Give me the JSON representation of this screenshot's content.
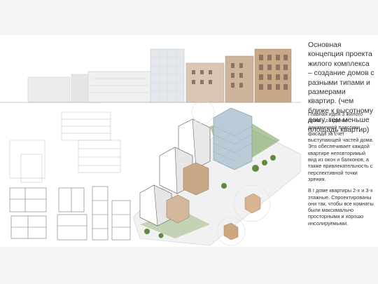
{
  "concept": {
    "title": "Основная концепция проекта жилого комплекса – создание домов с разными типами и размерами квартир. (чем ближе к высотному дому, тем меньше площадь квартир)"
  },
  "notes": {
    "facade": "Главная идея 3 жилого дома – создание динамичной пластики фасада за счет выступающей частей дома. Это обеспечивает каждой квартире неповторимый вид из окон и балконов, а также привлекательность с перспективной точки зрения.",
    "apartments": "В I доме квартиры 2-х и 3-х этажные. Спроектированы они так, чтобы все комнаты были максимально просторными и хорошо инсолируемыми."
  },
  "colors": {
    "facade_wood": "#c9a888",
    "facade_dark": "#7a6a5a",
    "glass": "#b9cbd6",
    "greenery": "#6f9a4e",
    "line": "#555555"
  }
}
